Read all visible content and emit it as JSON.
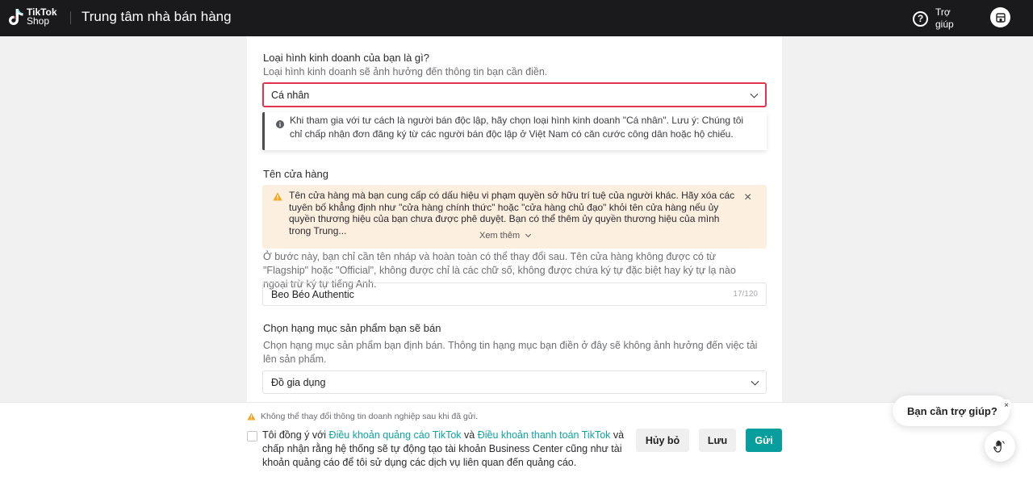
{
  "header": {
    "logo_brand": "TikTok",
    "logo_sub": "Shop",
    "title": "Trung tâm nhà bán hàng",
    "help_label": "Trợ giúp",
    "help_icon": "question-circle-icon",
    "avatar_icon": "store-icon"
  },
  "business_type": {
    "title": "Loại hình kinh doanh của bạn là gì?",
    "subtitle": "Loại hình kinh doanh sẽ ảnh hưởng đến thông tin bạn cần điền.",
    "selected": "Cá nhân",
    "tip": "Khi tham gia với tư cách là người bán độc lập, hãy chọn loại hình kinh doanh \"Cá nhân\". Lưu ý: Chúng tôi chỉ chấp nhận đơn đăng ký từ các người bán độc lập ở Việt Nam có căn cước công dân hoặc hộ chiếu."
  },
  "store_name": {
    "title": "Tên cửa hàng",
    "warning": "Tên cửa hàng mà bạn cung cấp có dấu hiệu vi phạm quyền sở hữu trí tuệ của người khác. Hãy xóa các tuyên bố khẳng định như \"cửa hàng chính thức\" hoặc \"cửa hàng chủ đạo\" khỏi tên cửa hàng nếu ủy quyền thương hiệu của bạn chưa được phê duyệt. Bạn có thể thêm ủy quyền thương hiệu của mình trong Trung...",
    "see_more": "Xem thêm",
    "hint": "Ở bước này, bạn chỉ cần tên nháp và hoàn toàn có thể thay đổi sau. Tên cửa hàng không được có từ \"Flagship\" hoặc \"Official\", không được chỉ là các chữ số, không được chứa ký tự đặc biệt hay ký tự lạ nào ngoại trừ ký tự tiếng Anh.",
    "value": "Beo Béo Authentic",
    "counter": "17/120"
  },
  "category": {
    "title": "Chọn hạng mục sản phẩm bạn sẽ bán",
    "subtitle": "Chọn hạng mục sản phẩm bạn định bán. Thông tin hạng mục bạn điền ở đây sẽ không ảnh hưởng đến việc tải lên sản phẩm.",
    "selected": "Đồ gia dụng"
  },
  "footer": {
    "notice": "Không thể thay đổi thông tin doanh nghiệp sau khi đã gửi.",
    "agree_prefix": "Tôi đồng ý với ",
    "link1": "Điều khoản quảng cáo TikTok",
    "agree_and": " và ",
    "link2": "Điều khoản thanh toán TikTok",
    "agree_suffix": " và chấp nhận rằng hệ thống sẽ tự động tạo tài khoản Business Center cũng như tài khoản quảng cáo để tôi sử dụng các dịch vụ liên quan đến quảng cáo.",
    "cancel": "Hủy bỏ",
    "save": "Lưu",
    "submit": "Gửi"
  },
  "assistant": {
    "bubble": "Bạn cần trợ giúp?",
    "close": "×",
    "icon": "hand-wave-icon"
  },
  "colors": {
    "accent": "#099e9e",
    "error_border": "#e2344f",
    "warning_bg": "#fdefe0",
    "warning_icon": "#f5a623"
  }
}
